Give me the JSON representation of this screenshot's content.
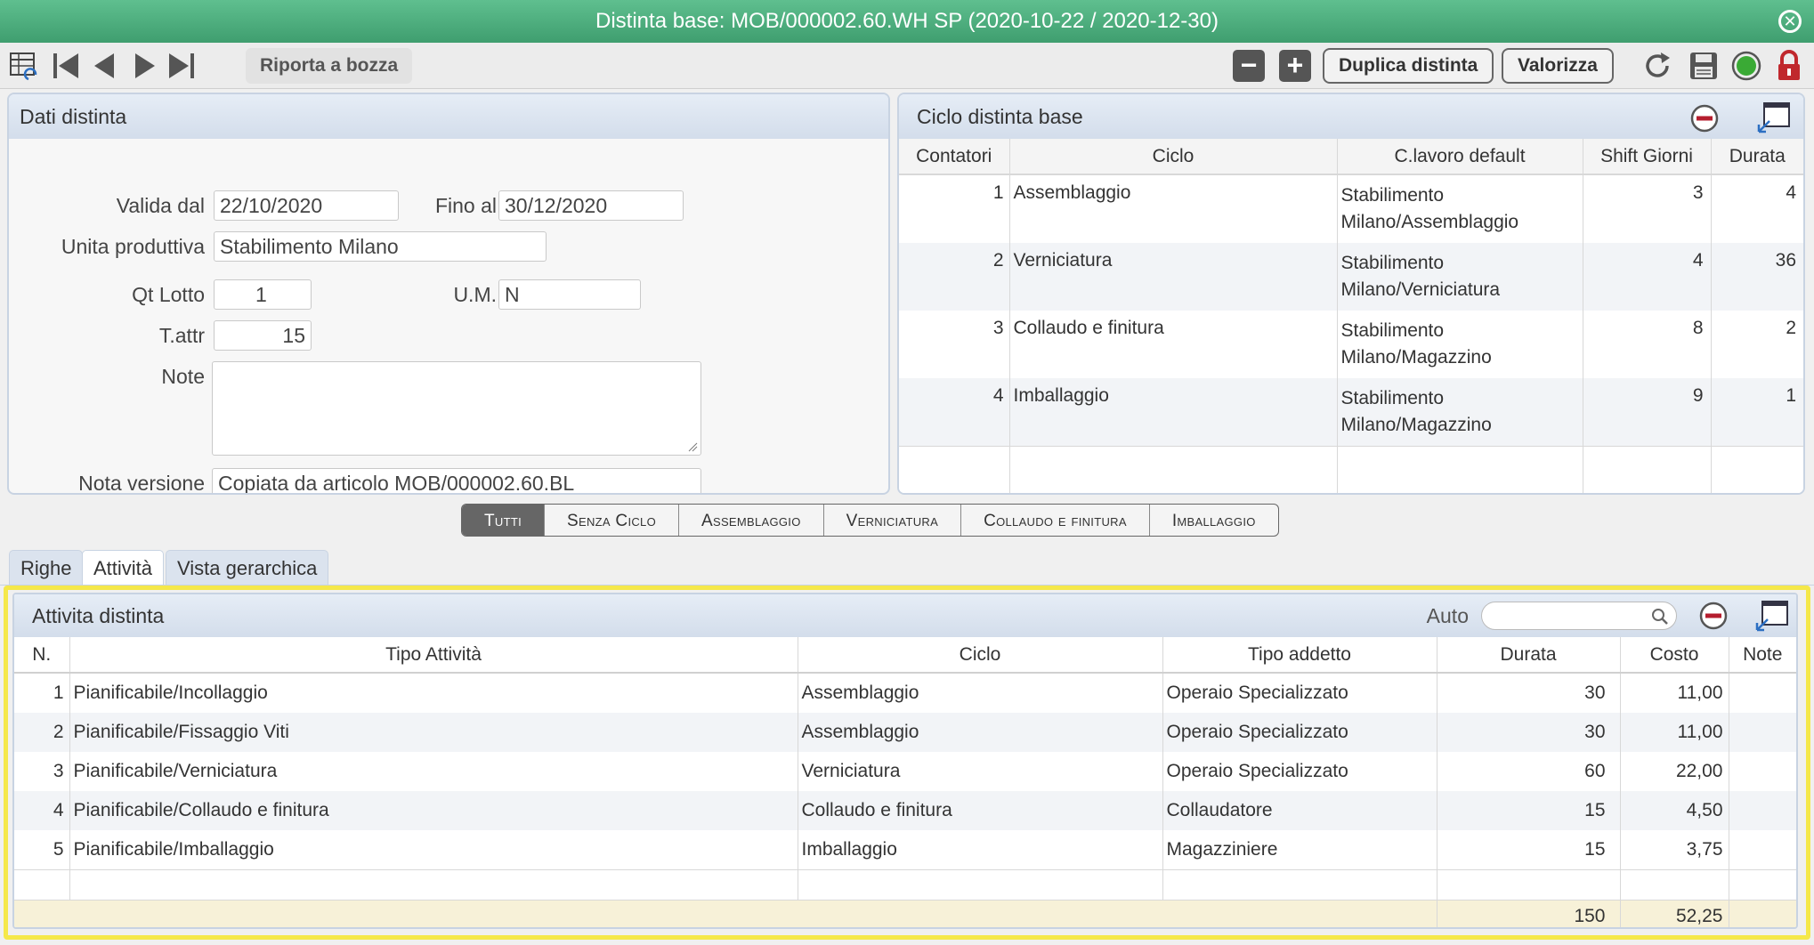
{
  "window": {
    "title": "Distinta base: MOB/000002.60.WH SP (2020-10-22 / 2020-12-30)"
  },
  "toolbar": {
    "revert_label": "Riporta a bozza",
    "duplicate_label": "Duplica distinta",
    "valorize_label": "Valorizza",
    "minus_label": "−",
    "plus_label": "+"
  },
  "dati": {
    "title": "Dati distinta",
    "valida_dal_label": "Valida dal",
    "valida_dal": "22/10/2020",
    "fino_al_label": "Fino al",
    "fino_al": "30/12/2020",
    "unita_label": "Unita produttiva",
    "unita": "Stabilimento Milano",
    "qt_lotto_label": "Qt Lotto",
    "qt_lotto": "1",
    "um_label": "U.M.",
    "um": "N",
    "tattr_label": "T.attr",
    "tattr": "15",
    "note_label": "Note",
    "note": "",
    "nota_versione_label": "Nota versione",
    "nota_versione": "Copiata da articolo MOB/000002.60.BL"
  },
  "ciclo": {
    "title": "Ciclo distinta base",
    "columns": [
      "Contatori",
      "Ciclo",
      "C.lavoro default",
      "Shift Giorni",
      "Durata"
    ],
    "rows": [
      {
        "n": "1",
        "ciclo": "Assemblaggio",
        "c1": "Stabilimento",
        "c2": "Milano/Assemblaggio",
        "shift": "3",
        "durata": "4"
      },
      {
        "n": "2",
        "ciclo": "Verniciatura",
        "c1": "Stabilimento",
        "c2": "Milano/Verniciatura",
        "shift": "4",
        "durata": "36"
      },
      {
        "n": "3",
        "ciclo": "Collaudo e finitura",
        "c1": "Stabilimento",
        "c2": "Milano/Magazzino",
        "shift": "8",
        "durata": "2"
      },
      {
        "n": "4",
        "ciclo": "Imballaggio",
        "c1": "Stabilimento",
        "c2": "Milano/Magazzino",
        "shift": "9",
        "durata": "1"
      }
    ]
  },
  "filters": [
    "Tutti",
    "Senza Ciclo",
    "Assemblaggio",
    "Verniciatura",
    "Collaudo e finitura",
    "Imballaggio"
  ],
  "tabs": [
    "Righe",
    "Attività",
    "Vista gerarchica"
  ],
  "attivita": {
    "title": "Attivita distinta",
    "auto_label": "Auto",
    "search_placeholder": "",
    "columns": [
      "N.",
      "Tipo Attività",
      "Ciclo",
      "Tipo addetto",
      "Durata",
      "Costo",
      "Note"
    ],
    "rows": [
      {
        "n": "1",
        "tipo": "Pianificabile/Incollaggio",
        "ciclo": "Assemblaggio",
        "addetto": "Operaio Specializzato",
        "durata": "30",
        "costo": "11,00",
        "note": ""
      },
      {
        "n": "2",
        "tipo": "Pianificabile/Fissaggio Viti",
        "ciclo": "Assemblaggio",
        "addetto": "Operaio Specializzato",
        "durata": "30",
        "costo": "11,00",
        "note": ""
      },
      {
        "n": "3",
        "tipo": "Pianificabile/Verniciatura",
        "ciclo": "Verniciatura",
        "addetto": "Operaio Specializzato",
        "durata": "60",
        "costo": "22,00",
        "note": ""
      },
      {
        "n": "4",
        "tipo": "Pianificabile/Collaudo e finitura",
        "ciclo": "Collaudo e finitura",
        "addetto": "Collaudatore",
        "durata": "15",
        "costo": "4,50",
        "note": ""
      },
      {
        "n": "5",
        "tipo": "Pianificabile/Imballaggio",
        "ciclo": "Imballaggio",
        "addetto": "Magazziniere",
        "durata": "15",
        "costo": "3,75",
        "note": ""
      }
    ],
    "totals": {
      "durata": "150",
      "costo": "52,25"
    }
  },
  "colors": {
    "title_bar": "#4caf7f",
    "highlight": "#f5e84a",
    "status_ok": "#3aaa35",
    "lock": "#c0282d"
  }
}
